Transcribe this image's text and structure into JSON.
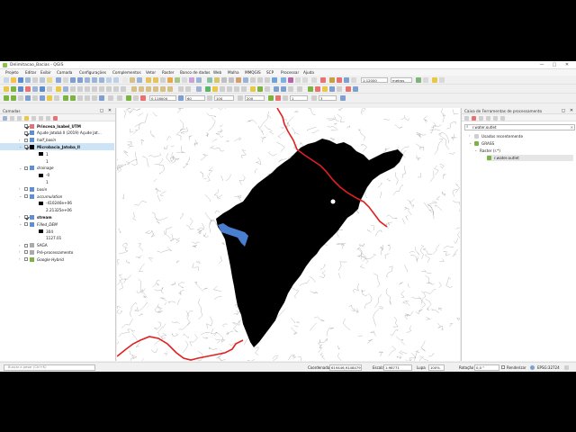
{
  "window": {
    "title": "Delimitacao_Bacias - QGIS",
    "buttons": [
      "—",
      "▢",
      "✕"
    ]
  },
  "menu": [
    "Projeto",
    "Editar",
    "Exibir",
    "Camada",
    "Configurações",
    "Complementos",
    "Vetor",
    "Raster",
    "Banco de dados",
    "Web",
    "Malha",
    "MMQGIS",
    "SCP",
    "Processar",
    "Ajuda"
  ],
  "toolbar": {
    "scale_combo": "1:12000",
    "unit_combo": "metros",
    "row3_value_a": "0,116000",
    "row3_value_b": "60",
    "row3_value_c": "100",
    "row3_value_d": "200",
    "row3_value_e": "1",
    "row3_value_f": "3"
  },
  "layers": {
    "title": "Camadas",
    "items": [
      {
        "label": "Princesa_Isabel_UTM",
        "style": "b",
        "checked": true,
        "swatch": "#e57373"
      },
      {
        "label": "Açude Jatobá II (2019) Açude Jat...",
        "style": "",
        "checked": true,
        "swatch": "#5c8fd6"
      },
      {
        "label": "half_basin",
        "style": "i",
        "checked": false,
        "swatch": "#5c8fd6"
      },
      {
        "label": "Microbacia_Jatoba_II",
        "style": "b",
        "checked": true,
        "swatch": "#000000"
      },
      {
        "label": "1",
        "style": "",
        "checked": false,
        "swatch": "#000000"
      },
      {
        "label": "1",
        "style": "",
        "checked": false,
        "swatch": ""
      },
      {
        "label": "drainage",
        "style": "i",
        "checked": false,
        "swatch": "#5c8fd6"
      },
      {
        "label": "-0",
        "style": "",
        "checked": false,
        "swatch": "#000000"
      },
      {
        "label": "1",
        "style": "",
        "checked": false,
        "swatch": ""
      },
      {
        "label": "basin",
        "style": "i",
        "checked": false,
        "swatch": "#5c8fd6"
      },
      {
        "label": "accumulation",
        "style": "i",
        "checked": false,
        "swatch": "#5c8fd6"
      },
      {
        "label": "-410246e+06",
        "style": "",
        "checked": false,
        "swatch": "#000000"
      },
      {
        "label": "2.21325e+06",
        "style": "",
        "checked": false,
        "swatch": ""
      },
      {
        "label": "stream",
        "style": "b",
        "checked": true,
        "swatch": "#5c8fd6"
      },
      {
        "label": "Filled_DEM",
        "style": "i",
        "checked": false,
        "swatch": "#5c8fd6"
      },
      {
        "label": "304",
        "style": "",
        "checked": false,
        "swatch": "#000000"
      },
      {
        "label": "1127.01",
        "style": "",
        "checked": false,
        "swatch": ""
      },
      {
        "label": "SAGA",
        "style": "",
        "checked": false,
        "swatch": "#aaaaaa"
      },
      {
        "label": "Pré-processamento",
        "style": "",
        "checked": false,
        "swatch": "#aaaaaa"
      },
      {
        "label": "Google Hybrid",
        "style": "i",
        "checked": false,
        "swatch": "#7cb342"
      }
    ]
  },
  "processing": {
    "title": "Caixa de Ferramentas de processamento",
    "search_value": "r.water.outlet",
    "tree": [
      {
        "label": "Usados recentemente",
        "depth": 0
      },
      {
        "label": "GRASS",
        "depth": 0
      },
      {
        "label": "Raster (r.*)",
        "depth": 1
      },
      {
        "label": "r.water.outlet",
        "depth": 2
      }
    ]
  },
  "statusbar": {
    "locator_placeholder": "Buscar a pesar (Ctrl+K)",
    "coord_label": "Coordenada",
    "coord_value": "619446,9148479",
    "scale_label": "Escala",
    "scale_value": "1:98771",
    "lupa_label": "Lupa",
    "lupa_value": "100%",
    "rotation_label": "Rotação",
    "rotation_value": "0,0 °",
    "render_label": "Renderizar",
    "crs_label": "EPSG:32724"
  },
  "colors": {
    "basin_fill": "#000000",
    "boundary_line": "#e02020",
    "reservoir": "#4a7fd0",
    "drainage": "#8a8a8a"
  }
}
